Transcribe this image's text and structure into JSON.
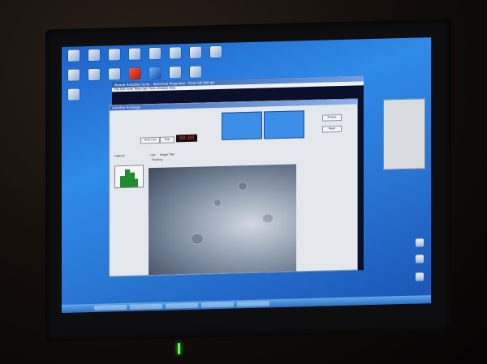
{
  "window": {
    "app_title": "Meade AutoStar Suite - Spherical Projection - Field Hill Mill-dd",
    "capture_title": "AutoStar Envisage",
    "menu": "File  Edit  View  Telescope  Tools  Window  Help"
  },
  "capture": {
    "timer": "00:00",
    "tab_capture": "Capture",
    "tab_live": "Live",
    "tab_image": "Image Title",
    "tracking_label": "Tracking",
    "start_button": "Start Live",
    "stop_button": "Stop",
    "browse_button": "Browse",
    "reset_button": "Reset"
  },
  "taskbar": {
    "items": [
      "",
      "",
      "",
      "",
      ""
    ]
  },
  "colors": {
    "desktop": "#2f8ae8",
    "timer": "#ff3b2f",
    "led": "#5cff4a"
  }
}
